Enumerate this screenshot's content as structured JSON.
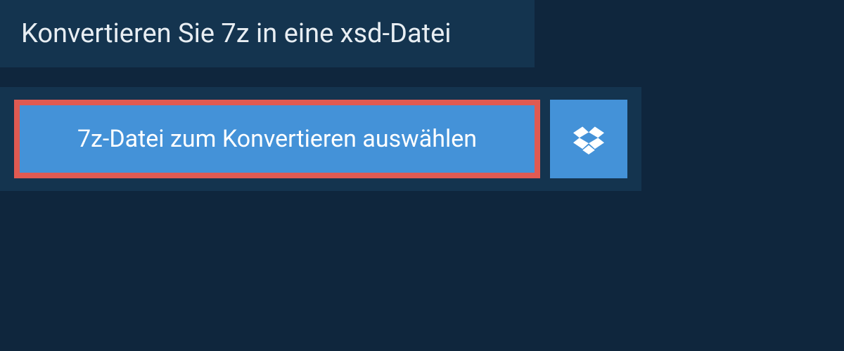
{
  "header": {
    "title": "Konvertieren Sie 7z in eine xsd-Datei"
  },
  "upload": {
    "select_label": "7z-Datei zum Konvertieren auswählen"
  }
}
